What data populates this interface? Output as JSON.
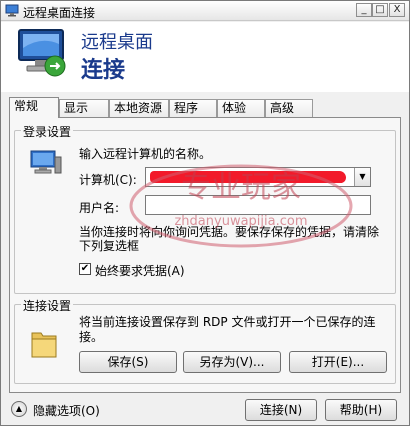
{
  "window": {
    "title": "远程桌面连接",
    "controls": {
      "minimize": "_",
      "maximize": "□",
      "close": "X"
    }
  },
  "header": {
    "line1": "远程桌面",
    "line2": "连接",
    "icon": "remote-desktop-monitor-icon"
  },
  "tabs": [
    {
      "label": "常规",
      "active": true
    },
    {
      "label": "显示"
    },
    {
      "label": "本地资源"
    },
    {
      "label": "程序"
    },
    {
      "label": "体验"
    },
    {
      "label": "高级"
    }
  ],
  "login": {
    "group_title": "登录设置",
    "prompt": "输入远程计算机的名称。",
    "computer_label": "计算机(C):",
    "computer_value": "",
    "username_label": "用户名:",
    "username_value": "",
    "note": "当你连接时将向你询问凭据。要保存保存的凭据，请清除下列复选框",
    "always_ask_label": "始终要求凭据(A)",
    "always_ask_checked": true
  },
  "connection": {
    "group_title": "连接设置",
    "note": "将当前连接设置保存到 RDP 文件或打开一个已保存的连接。",
    "save": "保存(S)",
    "save_as": "另存为(V)...",
    "open": "打开(E)..."
  },
  "footer": {
    "hide_options": "隐藏选项(O)",
    "connect": "连接(N)",
    "help": "帮助(H)"
  },
  "watermark": {
    "line1": "专业玩家",
    "line2": "zhdanyuwapijia.com"
  },
  "colors": {
    "header_text": "#1a3a8c",
    "redaction": "#f21a2a"
  }
}
